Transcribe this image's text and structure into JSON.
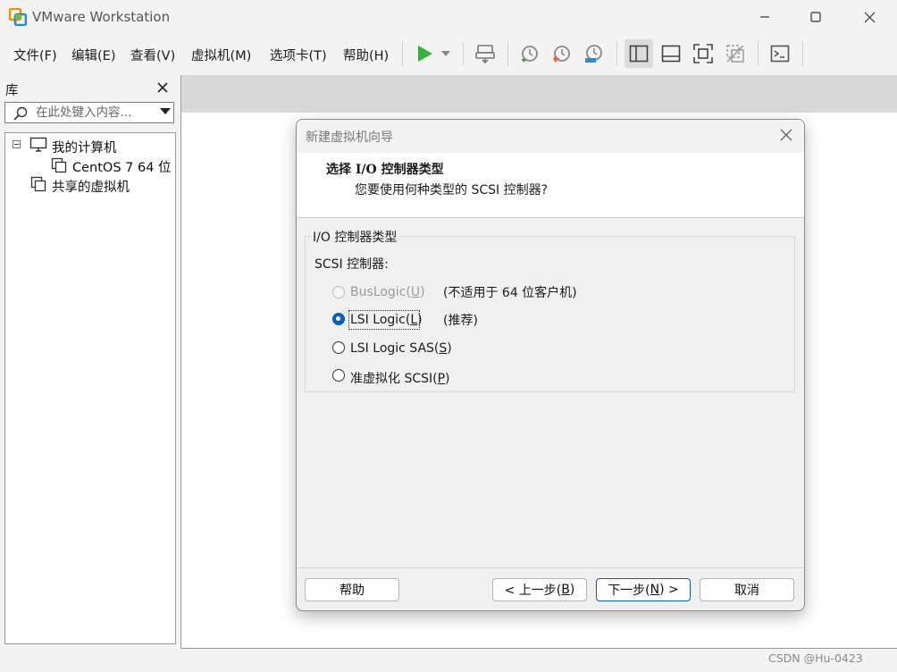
{
  "window": {
    "title": "VMware Workstation",
    "controls": [
      "minimize",
      "maximize",
      "close"
    ]
  },
  "menu": [
    {
      "label": "文件(F)"
    },
    {
      "label": "编辑(E)"
    },
    {
      "label": "查看(V)"
    },
    {
      "label": "虚拟机(M)"
    },
    {
      "label": "选项卡(T)"
    },
    {
      "label": "帮助(H)"
    }
  ],
  "toolbar": {
    "icons": [
      "play-icon",
      "dropdown-icon",
      "send-keys-icon",
      "snapshot-take-icon",
      "snapshot-revert-icon",
      "snapshot-manager-icon",
      "show-library-icon",
      "show-thumbnail-bar-icon",
      "full-screen-icon",
      "unity-icon",
      "console-view-icon"
    ],
    "accent_color": "#3cae3c"
  },
  "library": {
    "title": "库",
    "search_placeholder": "在此处键入内容...",
    "tree": [
      {
        "label": "我的计算机",
        "expanded": true,
        "children": [
          {
            "label": "CentOS 7 64 位"
          }
        ]
      },
      {
        "label": "共享的虚拟机"
      }
    ]
  },
  "dialog": {
    "title": "新建虚拟机向导",
    "heading": "选择 I/O 控制器类型",
    "subheading": "您要使用何种类型的 SCSI 控制器?",
    "group_title": "I/O 控制器类型",
    "field_label": "SCSI 控制器:",
    "options": [
      {
        "label_main": "BusLogic(",
        "mnemonic": "U",
        "label_end": ")",
        "note": "(不适用于 64 位客户机)",
        "enabled": false,
        "selected": false
      },
      {
        "label_main": "LSI Logic(",
        "mnemonic": "L",
        "label_end": ")",
        "note": "(推荐)",
        "enabled": true,
        "selected": true
      },
      {
        "label_main": "LSI Logic SAS(",
        "mnemonic": "S",
        "label_end": ")",
        "note": "",
        "enabled": true,
        "selected": false
      },
      {
        "label_main": "准虚拟化 SCSI(",
        "mnemonic": "P",
        "label_end": ")",
        "note": "",
        "enabled": true,
        "selected": false
      }
    ],
    "buttons": {
      "help": "帮助",
      "back_main": "< 上一步(",
      "back_mnemonic": "B",
      "back_end": ")",
      "next_main": "下一步(",
      "next_mnemonic": "N",
      "next_end": ") >",
      "cancel": "取消"
    },
    "selected_color": "#0a5fb4"
  },
  "watermark": "CSDN @Hu-0423"
}
